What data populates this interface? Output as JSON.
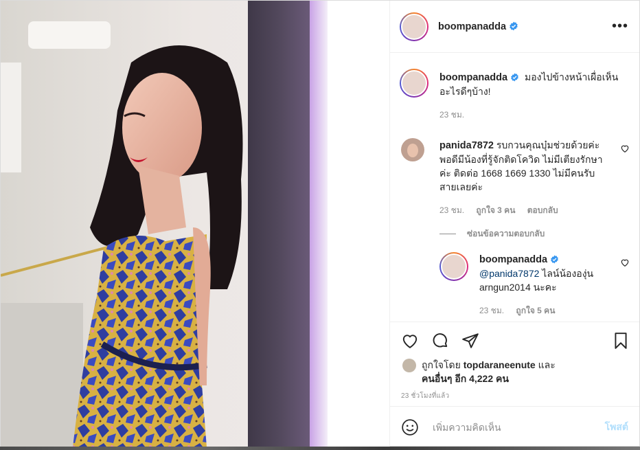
{
  "post": {
    "author": "boompanadda",
    "verified_icon": "verified-badge-icon",
    "more_icon": "more-options-icon"
  },
  "caption": {
    "username": "boompanadda",
    "text": "มองไปข้างหน้าเผื่อเห็นอะไรดีๆบ้าง!",
    "time": "23 ชม."
  },
  "comments": [
    {
      "username": "panida7872",
      "text": "รบกวนคุณบุ๋มช่วยด้วยค่ะ พอดีมีน้องที่รู้จักติดโควิด ไม่มีเตียงรักษาค่ะ ติดต่อ 1668 1669 1330 ไม่มีคนรับสายเลยค่ะ",
      "time": "23 ชม.",
      "likes": "ถูกใจ 3 คน",
      "reply_label": "ตอบกลับ"
    }
  ],
  "hide_replies_label": "ซ่อนข้อความตอบกลับ",
  "reply": {
    "username": "boompanadda",
    "mention": "@panida7872",
    "text": " ไลน์น้ององุ่น arngun2014 นะคะ",
    "time": "23 ชม.",
    "likes": "ถูกใจ 5 คน"
  },
  "liked_by": {
    "prefix": "ถูกใจโดย ",
    "user": "topdaraneenute",
    "middle": " และ ",
    "others": "คนอื่นๆ อีก 4,222 คน"
  },
  "timestamp": "23 ชั่วโมงที่แล้ว",
  "add_comment": {
    "placeholder": "เพิ่มความคิดเห็น",
    "post_label": "โพสต์"
  },
  "colors": {
    "verified": "#3897f0",
    "post_button_disabled": "#b2dffc",
    "muted": "#8e8e8e",
    "text": "#262626"
  }
}
